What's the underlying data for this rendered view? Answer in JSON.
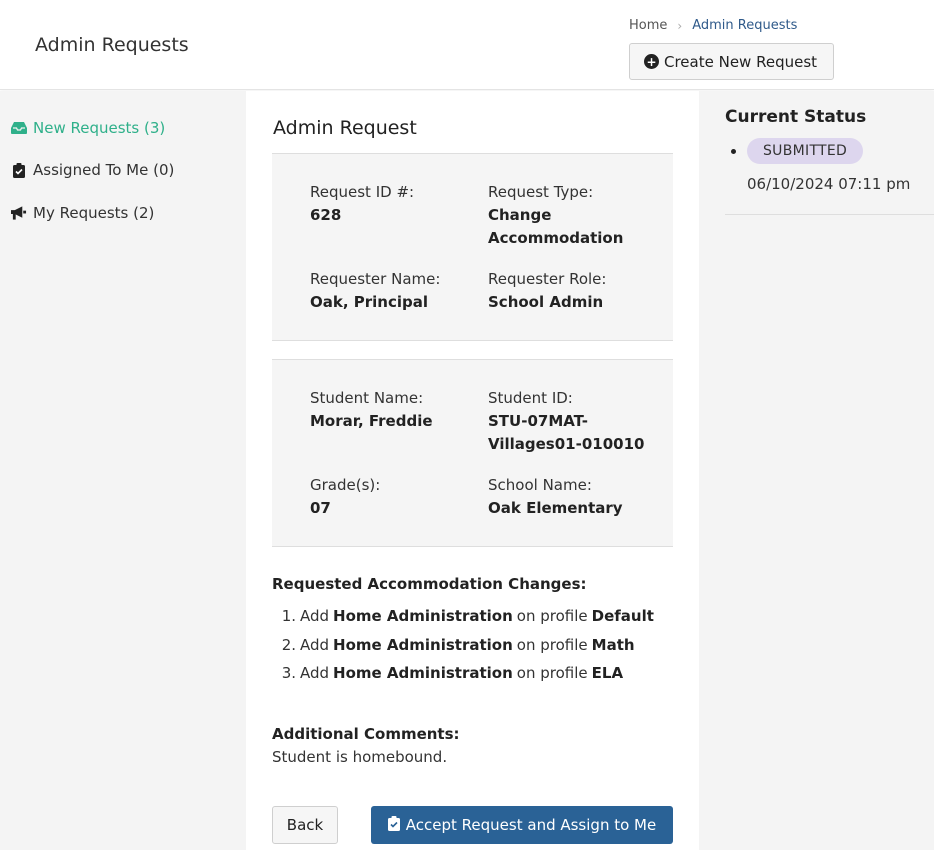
{
  "header": {
    "title": "Admin Requests",
    "breadcrumb": {
      "home": "Home",
      "current": "Admin Requests"
    },
    "create_button": "Create New Request"
  },
  "sidebar": {
    "items": [
      {
        "label": "New Requests (3)",
        "icon": "inbox-icon",
        "active": true
      },
      {
        "label": "Assigned To Me (0)",
        "icon": "clipboard-check-icon",
        "active": false
      },
      {
        "label": "My Requests (2)",
        "icon": "megaphone-icon",
        "active": false
      }
    ]
  },
  "request": {
    "title": "Admin Request",
    "id_label": "Request ID #:",
    "id_value": "628",
    "type_label": "Request Type:",
    "type_value_1": "Change",
    "type_value_2": "Accommodation",
    "requester_label": "Requester Name:",
    "requester_value": "Oak, Principal",
    "role_label": "Requester Role:",
    "role_value": "School Admin",
    "student_name_label": "Student Name:",
    "student_name_value": "Morar, Freddie",
    "student_id_label": "Student ID:",
    "student_id_value_1": "STU-07MAT-",
    "student_id_value_2": "Villages01-010010",
    "grade_label": "Grade(s):",
    "grade_value": "07",
    "school_label": "School Name:",
    "school_value": "Oak Elementary",
    "changes_title": "Requested Accommodation Changes:",
    "changes": [
      {
        "num": "1.",
        "action": "Add",
        "accommodation": "Home Administration",
        "connector": "on profile",
        "profile": "Default"
      },
      {
        "num": "2.",
        "action": "Add",
        "accommodation": "Home Administration",
        "connector": "on profile",
        "profile": "Math"
      },
      {
        "num": "3.",
        "action": "Add",
        "accommodation": "Home Administration",
        "connector": "on profile",
        "profile": "ELA"
      }
    ],
    "comments_title": "Additional Comments:",
    "comments_text": "Student is homebound.",
    "back_button": "Back",
    "accept_button": "Accept Request and Assign to Me"
  },
  "status": {
    "title": "Current Status",
    "badge": "SUBMITTED",
    "timestamp": "06/10/2024 07:11 pm"
  },
  "colors": {
    "accent_green": "#2fb08a",
    "primary_blue": "#2a6296",
    "badge_purple": "#ddd6ee"
  }
}
